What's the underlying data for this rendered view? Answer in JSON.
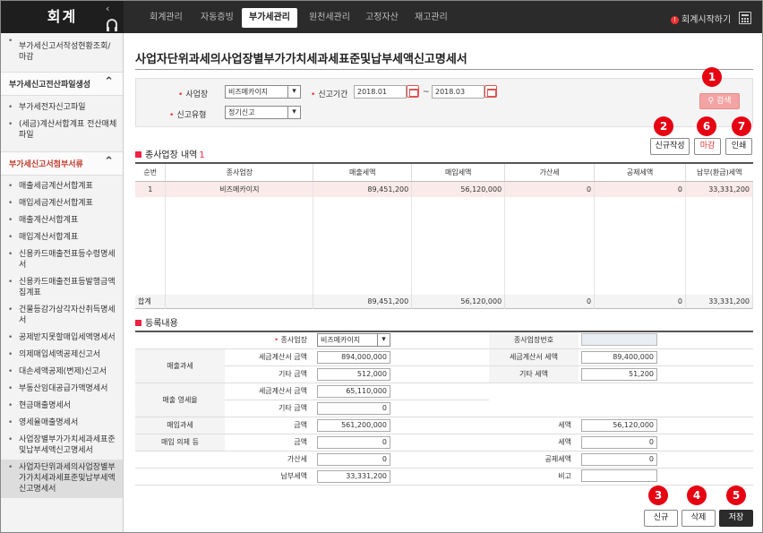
{
  "app": {
    "title": "회계"
  },
  "topnav": {
    "tabs": [
      "회계관리",
      "자동증빙",
      "부가세관리",
      "원천세관리",
      "고정자산",
      "재고관리"
    ],
    "start_label": "회계시작하기"
  },
  "sidebar": {
    "item0": "부가세신고서작성현황조회/마감",
    "group1": "부가세신고전산파일생성",
    "g1_items": [
      "부가세전자신고파일",
      "(세금)계산서합계표 전산매체파일"
    ],
    "group2": "부가세신고서첨부서류",
    "g2_items": [
      "매출세금계산서합계표",
      "매입세금계산서합계표",
      "매출계산서합계표",
      "매입계산서합계표",
      "신용카드매출전표등수령명세서",
      "신용카드매출전표등발행금액집계표",
      "건물등감가상각자산취득명세서",
      "공제받지못할매입세액명세서",
      "의제매입세액공제신고서",
      "대손세액공제(변제)신고서",
      "부동산임대공급가액명세서",
      "현금매출명세서",
      "영세율매출명세서",
      "사업장별부가가치세과세표준및납부세액신고명세서",
      "사업자단위과세의사업장별부가가치세과세표준및납부세액신고명세서"
    ]
  },
  "page": {
    "title": "사업자단위과세의사업장별부가가치세과세표준및납부세액신고명세서"
  },
  "filter": {
    "business_label": "사업장",
    "business_value": "비즈메카이지",
    "period_label": "신고기간",
    "period_from": "2018.01",
    "period_sep": "~",
    "period_to": "2018.03",
    "type_label": "신고유형",
    "type_value": "정기신고",
    "search_label": "검색"
  },
  "actions": {
    "new_label": "신규작성",
    "close_label": "마감",
    "print_label": "인쇄"
  },
  "list": {
    "section_title": "종사업장 내역",
    "count": "1",
    "headers": [
      "순번",
      "종사업장",
      "매출세액",
      "매입세액",
      "가산세",
      "공제세액",
      "납부(환급)세액"
    ],
    "rows": [
      [
        "1",
        "비즈메카이지",
        "89,451,200",
        "56,120,000",
        "0",
        "0",
        "33,331,200"
      ]
    ],
    "sum_label": "합계",
    "sum": [
      "89,451,200",
      "56,120,000",
      "0",
      "0",
      "33,331,200"
    ]
  },
  "reg": {
    "section_title": "등록내용",
    "biz_label": "종사업장",
    "biz_value": "비즈메카이지",
    "bizno_label": "종사업장번호",
    "sales_tax_label": "매출과세",
    "tax_invoice_amount_label": "세금계산서 금액",
    "tax_invoice_amount": "894,000,000",
    "tax_invoice_tax_label": "세금계산서 세액",
    "tax_invoice_tax": "89,400,000",
    "other_amount_label": "기타 금액",
    "other_amount": "512,000",
    "other_tax_label": "기타 세액",
    "other_tax": "51,200",
    "zero_rate_label": "매출 영세율",
    "zr_invoice_amount_label": "세금계산서 금액",
    "zr_invoice_amount": "65,110,000",
    "zr_other_amount_label": "기타 금액",
    "zr_other_amount": "0",
    "purchase_tax_label": "매입과세",
    "purchase_amount_label": "금액",
    "purchase_amount": "561,200,000",
    "purchase_tax_amt_label": "세액",
    "purchase_tax_amt": "56,120,000",
    "deemed_label": "매입 의제 등",
    "deemed_amount_label": "금액",
    "deemed_amount": "0",
    "deemed_tax_label": "세액",
    "deemed_tax": "0",
    "addtax_label": "가산세",
    "addtax": "0",
    "deduct_label": "공제세액",
    "deduct": "0",
    "payable_label": "납부세액",
    "payable": "33,331,200",
    "note_label": "비고"
  },
  "bottom": {
    "new_label": "신규",
    "delete_label": "삭제",
    "save_label": "저장"
  },
  "badges": [
    "1",
    "2",
    "3",
    "4",
    "5",
    "6",
    "7"
  ],
  "colors": {
    "accent": "#e60012",
    "topbar": "#2b2b2b",
    "search_btn": "#f3a3a3"
  }
}
